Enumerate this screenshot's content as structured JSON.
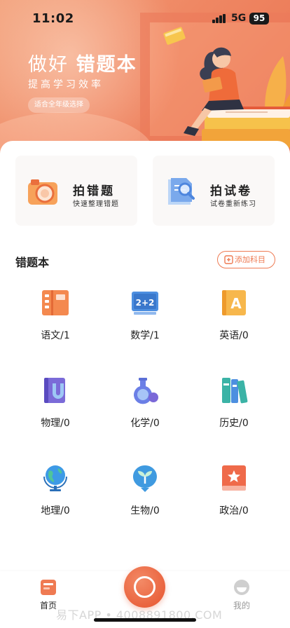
{
  "status_bar": {
    "time": "11:02",
    "network": "5G",
    "battery": "95"
  },
  "banner": {
    "title_prefix": "做好",
    "title_bold": "错题本",
    "subtitle": "提高学习效率",
    "badge": "适合全年级选择"
  },
  "quick_actions": [
    {
      "title": "拍错题",
      "desc": "快速整理错题",
      "icon": "camera-icon"
    },
    {
      "title": "拍试卷",
      "desc": "试卷重新练习",
      "icon": "document-search-icon"
    }
  ],
  "notebook": {
    "title": "错题本",
    "add_label": "添加科目"
  },
  "subjects": [
    {
      "label": "语文/1",
      "icon": "book-icon"
    },
    {
      "label": "数学/1",
      "icon": "blackboard-icon"
    },
    {
      "label": "英语/0",
      "icon": "letter-a-book-icon"
    },
    {
      "label": "物理/0",
      "icon": "magnet-book-icon"
    },
    {
      "label": "化学/0",
      "icon": "flask-icon"
    },
    {
      "label": "历史/0",
      "icon": "books-icon"
    },
    {
      "label": "地理/0",
      "icon": "globe-icon"
    },
    {
      "label": "生物/0",
      "icon": "sprout-icon"
    },
    {
      "label": "政治/0",
      "icon": "star-book-icon"
    }
  ],
  "tabbar": {
    "home_label": "首页",
    "me_label": "我的"
  },
  "watermark": "易下APP • 4008891800.COM",
  "colors": {
    "accent": "#ee7a52",
    "banner": "#ef8763",
    "tab_active": "#222222",
    "tab_inactive": "#999999"
  }
}
